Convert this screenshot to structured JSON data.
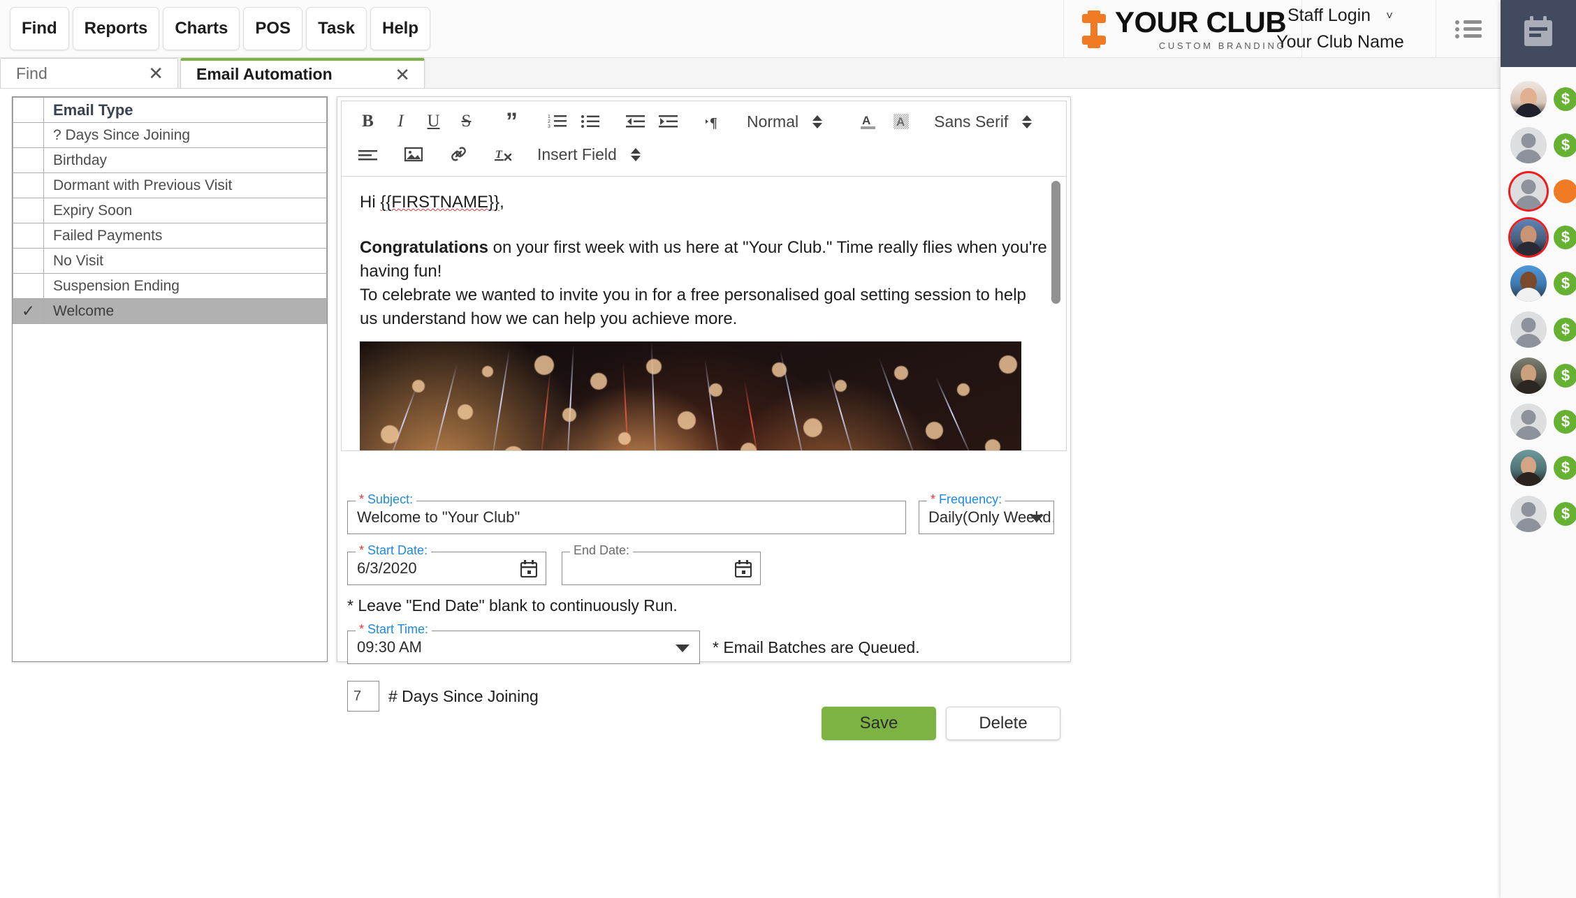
{
  "topnav": {
    "buttons": [
      {
        "label": "Find",
        "name": "nav-find"
      },
      {
        "label": "Reports",
        "name": "nav-reports"
      },
      {
        "label": "Charts",
        "name": "nav-charts"
      },
      {
        "label": "POS",
        "name": "nav-pos"
      },
      {
        "label": "Task",
        "name": "nav-task"
      },
      {
        "label": "Help",
        "name": "nav-help"
      }
    ]
  },
  "brand": {
    "main": "YOUR CLUB",
    "sub": "CUSTOM BRANDING",
    "logo_icon": "dumbbell-icon",
    "accent_color": "#f07b24"
  },
  "user": {
    "staff_login": "Staff Login",
    "club_name": "Your Club Name",
    "caret": "˅"
  },
  "tabs": [
    {
      "label": "Find",
      "close": "✕",
      "active": false
    },
    {
      "label": "Email Automation",
      "close": "✕",
      "active": true
    }
  ],
  "email_types": {
    "header": "Email Type",
    "rows": [
      {
        "label": "? Days Since Joining",
        "selected": false
      },
      {
        "label": "Birthday",
        "selected": false
      },
      {
        "label": "Dormant with Previous Visit",
        "selected": false
      },
      {
        "label": "Expiry Soon",
        "selected": false
      },
      {
        "label": "Failed Payments",
        "selected": false
      },
      {
        "label": "No Visit",
        "selected": false
      },
      {
        "label": "Suspension Ending",
        "selected": false
      },
      {
        "label": "Welcome",
        "selected": true
      }
    ],
    "check_glyph": "✓"
  },
  "editor_toolbar": {
    "row1": [
      {
        "name": "bold-icon",
        "glyph": "B"
      },
      {
        "name": "italic-icon",
        "glyph": "I"
      },
      {
        "name": "underline-icon",
        "glyph": "U"
      },
      {
        "name": "strikethrough-icon",
        "glyph": "S"
      },
      {
        "name": "blockquote-icon",
        "glyph": "”"
      },
      {
        "name": "ordered-list-icon",
        "glyph": "1."
      },
      {
        "name": "bullet-list-icon",
        "glyph": "•"
      },
      {
        "name": "outdent-icon",
        "glyph": "⇤"
      },
      {
        "name": "indent-icon",
        "glyph": "⇥"
      },
      {
        "name": "text-direction-icon",
        "glyph": "¶"
      }
    ],
    "row2": [
      {
        "name": "align-icon",
        "glyph": "≡"
      },
      {
        "name": "image-icon",
        "glyph": "Ὓc"
      },
      {
        "name": "link-icon",
        "glyph": "🔗"
      },
      {
        "name": "clear-format-icon",
        "glyph": "Tx"
      }
    ],
    "heading_select": "Normal",
    "font_select": "Sans Serif",
    "insert_field_select": "Insert Field",
    "text_color_icon": "text-color-icon",
    "background_color_icon": "background-color-icon"
  },
  "email_body": {
    "greeting_prefix": "Hi ",
    "merge_field": "{{FIRSTNAME}}",
    "greeting_suffix": ",",
    "bold_lead": "Congratulations",
    "paragraph1": " on your first week with us here at \"Your Club.\" Time really flies when you're having fun!",
    "paragraph2": "To celebrate we wanted to invite you in for a free personalised goal setting session to help us understand how we can help you achieve more.",
    "image_alt": "fireworks-banner-image"
  },
  "form": {
    "subject": {
      "label": "Subject:",
      "required": true,
      "value": "Welcome to \"Your Club\""
    },
    "frequency": {
      "label": "Frequency:",
      "required": true,
      "value": "Daily(Only Weekd…"
    },
    "start_date": {
      "label": "Start Date:",
      "required": true,
      "value": "6/3/2020"
    },
    "end_date": {
      "label": "End Date:",
      "required": false,
      "value": ""
    },
    "end_date_hint": "* Leave \"End Date\" blank to continuously Run.",
    "start_time": {
      "label": "Start Time:",
      "required": true,
      "value": "09:30 AM"
    },
    "queue_hint": "* Email Batches are Queued.",
    "days_since_joining": {
      "value": "7",
      "label": "# Days Since Joining"
    },
    "required_marker": "*"
  },
  "actions": {
    "save_label": "Save",
    "delete_label": "Delete",
    "save_color": "#7cb342"
  },
  "rail": {
    "head_icon": "calendar-agenda-icon",
    "members": [
      {
        "avatar": "photo1",
        "badge": "$",
        "badge_color": "green",
        "ring": false
      },
      {
        "avatar": "placeholder",
        "badge": "$",
        "badge_color": "green",
        "ring": false
      },
      {
        "avatar": "placeholder",
        "badge": "",
        "badge_color": "orange",
        "ring": true
      },
      {
        "avatar": "photo2",
        "badge": "$",
        "badge_color": "green",
        "ring": true
      },
      {
        "avatar": "photo3",
        "badge": "$",
        "badge_color": "green",
        "ring": false
      },
      {
        "avatar": "placeholder",
        "badge": "$",
        "badge_color": "green",
        "ring": false
      },
      {
        "avatar": "photo4",
        "badge": "$",
        "badge_color": "green",
        "ring": false
      },
      {
        "avatar": "placeholder",
        "badge": "$",
        "badge_color": "green",
        "ring": false
      },
      {
        "avatar": "photo5",
        "badge": "$",
        "badge_color": "green",
        "ring": false
      },
      {
        "avatar": "placeholder",
        "badge": "$",
        "badge_color": "green",
        "ring": false
      }
    ]
  }
}
